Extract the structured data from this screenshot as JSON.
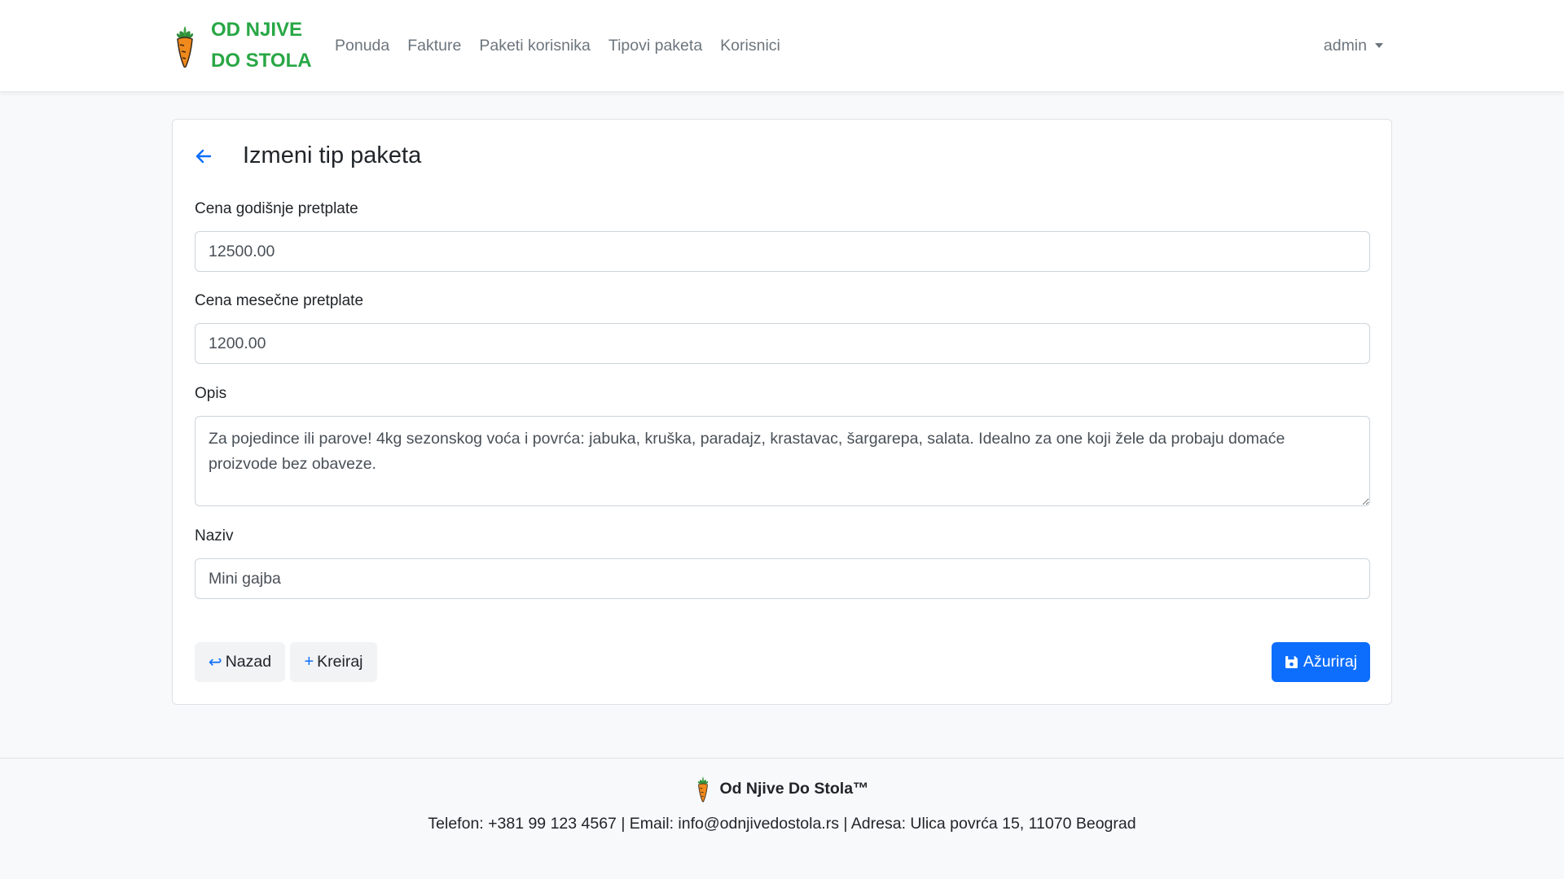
{
  "brand": {
    "line1": "OD NJIVE",
    "line2": "DO STOLA",
    "color": "#28a745"
  },
  "nav": {
    "items": [
      {
        "label": "Ponuda"
      },
      {
        "label": "Fakture"
      },
      {
        "label": "Paketi korisnika"
      },
      {
        "label": "Tipovi paketa"
      },
      {
        "label": "Korisnici"
      }
    ],
    "user": "admin"
  },
  "form": {
    "title": "Izmeni tip paketa",
    "yearly_price_label": "Cena godišnje pretplate",
    "yearly_price_value": "12500.00",
    "monthly_price_label": "Cena mesečne pretplate",
    "monthly_price_value": "1200.00",
    "description_label": "Opis",
    "description_value": "Za pojedince ili parove! 4kg sezonskog voća i povrća: jabuka, kruška, paradajz, krastavac, šargarepa, salata. Idealno za one koji žele da probaju domaće proizvode bez obaveze.",
    "name_label": "Naziv",
    "name_value": "Mini gajba"
  },
  "buttons": {
    "back_label": "Nazad",
    "create_label": "Kreiraj",
    "update_label": "Ažuriraj",
    "primary_color": "#0d6efd"
  },
  "footer": {
    "brand": "Od Njive Do Stola™",
    "contact": "Telefon: +381 99 123 4567 | Email: info@odnjivedostola.rs | Adresa: Ulica povrća 15, 11070 Beograd"
  },
  "icons": {
    "logo": "carrot-icon",
    "back": "arrow-left-icon",
    "return": "return-arrow-icon",
    "plus": "plus-icon",
    "save": "floppy-disk-icon",
    "dropdown": "caret-down-icon"
  }
}
